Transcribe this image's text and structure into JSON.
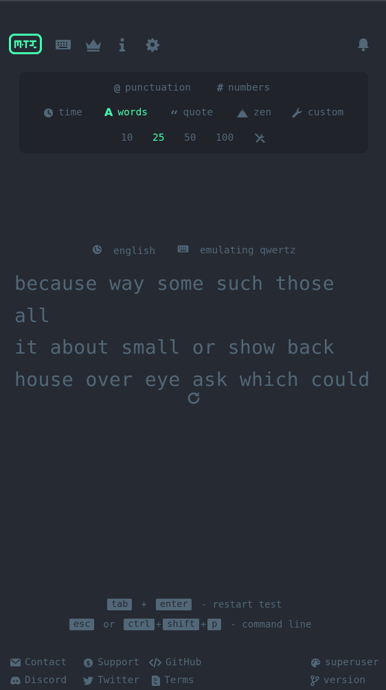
{
  "nav": {
    "logo_text": "mt",
    "icons": [
      "keyboard-icon",
      "crown-icon",
      "info-icon",
      "gear-icon",
      "bell-icon"
    ]
  },
  "config": {
    "punctuation": "punctuation",
    "numbers": "numbers",
    "modes": {
      "time": "time",
      "words": "words",
      "quote": "quote",
      "zen": "zen",
      "custom": "custom"
    },
    "active_mode": "words",
    "counts": [
      "10",
      "25",
      "50",
      "100"
    ],
    "active_count": "25"
  },
  "test": {
    "language": "english",
    "layout": "emulating qwertz",
    "lines": [
      "because way some such those all",
      "it about small or show back",
      "house over eye ask which could"
    ]
  },
  "hints": {
    "tab": "tab",
    "plus1": "+",
    "enter": "enter",
    "restart_text": "- restart test",
    "esc": "esc",
    "or": "or",
    "ctrl": "ctrl",
    "plus2": "+",
    "shift": "shift",
    "plus3": "+",
    "p": "p",
    "command_text": "- command line"
  },
  "footer": {
    "contact": "Contact",
    "support": "Support",
    "github": "GitHub",
    "discord": "Discord",
    "twitter": "Twitter",
    "terms": "Terms",
    "theme": "superuser",
    "version": "version"
  },
  "colors": {
    "background": "#262a33",
    "sub": "#526777",
    "main": "#43ffaf",
    "panel": "#20232a"
  }
}
